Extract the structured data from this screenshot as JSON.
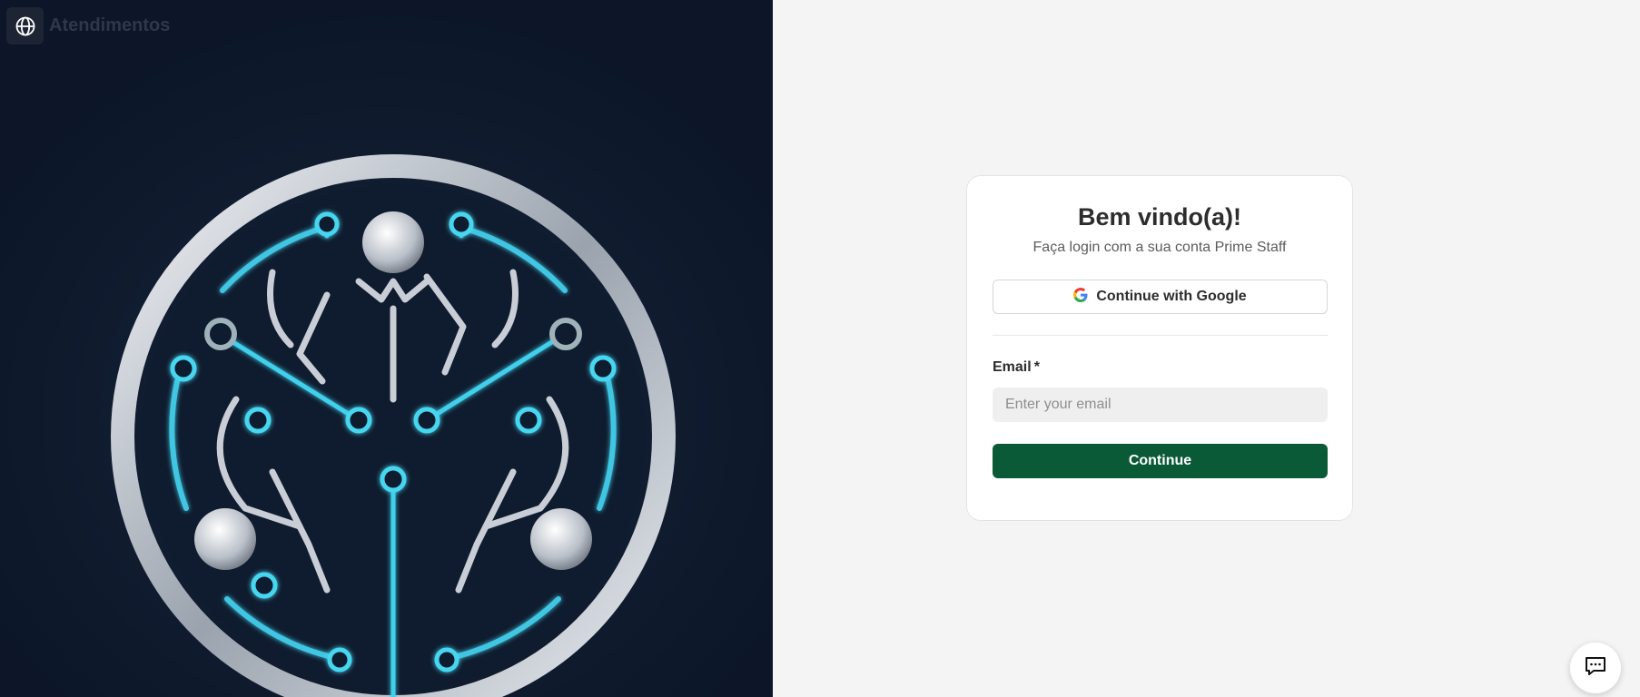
{
  "brand": {
    "icon": "globe-icon",
    "title": "Atendimentos"
  },
  "login": {
    "title": "Bem vindo(a)!",
    "subtitle": "Faça login com a sua conta Prime Staff",
    "google_label": "Continue with Google",
    "email_label": "Email",
    "email_required_mark": "*",
    "email_placeholder": "Enter your email",
    "email_value": "",
    "continue_label": "Continue"
  },
  "chat": {
    "icon": "chat-bubble-icon"
  },
  "colors": {
    "left_panel_bg": "#0c1628",
    "page_bg": "#f4f4f4",
    "primary_button": "#0b5a37",
    "art_accent": "#3fd0ec",
    "art_silver": "#c9ced6"
  }
}
